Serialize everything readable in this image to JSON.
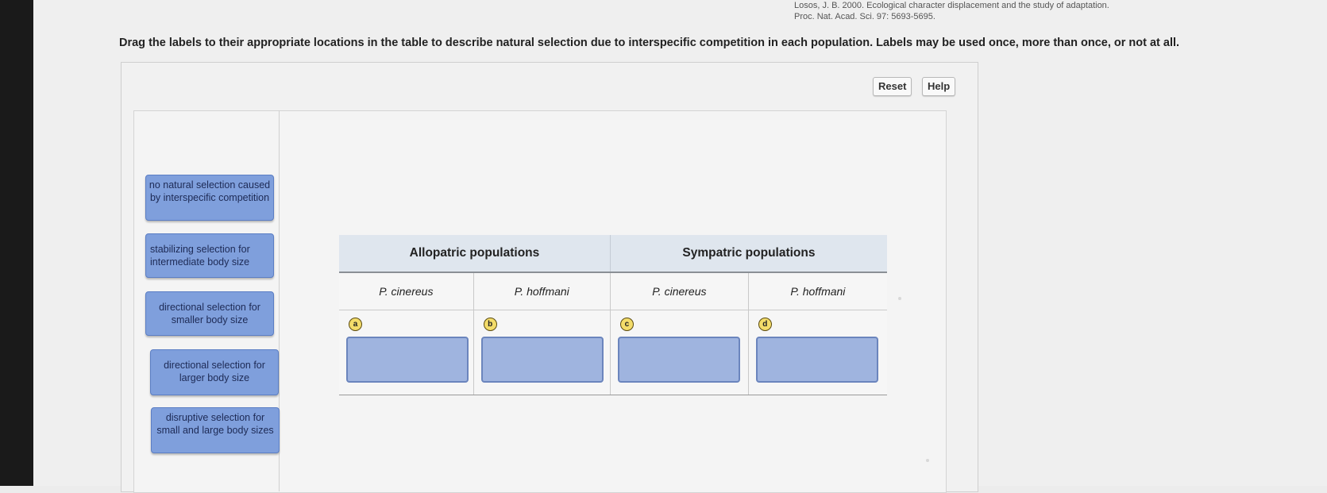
{
  "citation": {
    "line1": "Losos, J. B. 2000. Ecological character displacement and the study of adaptation.",
    "line2": "Proc. Nat. Acad. Sci. 97: 5693-5695."
  },
  "instructions": "Drag the labels to their appropriate locations in the table to describe natural selection due to interspecific competition in each population. Labels may be used once, more than once, or not at all.",
  "buttons": {
    "reset": "Reset",
    "help": "Help"
  },
  "labels": [
    "no natural selection caused by interspecific competition",
    "stabilizing selection for intermediate body size",
    "directional selection for smaller body size",
    "directional selection for larger body size",
    "disruptive selection for small and large body sizes"
  ],
  "table": {
    "headers": [
      "Allopatric populations",
      "Sympatric populations"
    ],
    "species": [
      "P. cinereus",
      "P. hoffmani",
      "P. cinereus",
      "P. hoffmani"
    ],
    "markers": [
      "a",
      "b",
      "c",
      "d"
    ]
  }
}
